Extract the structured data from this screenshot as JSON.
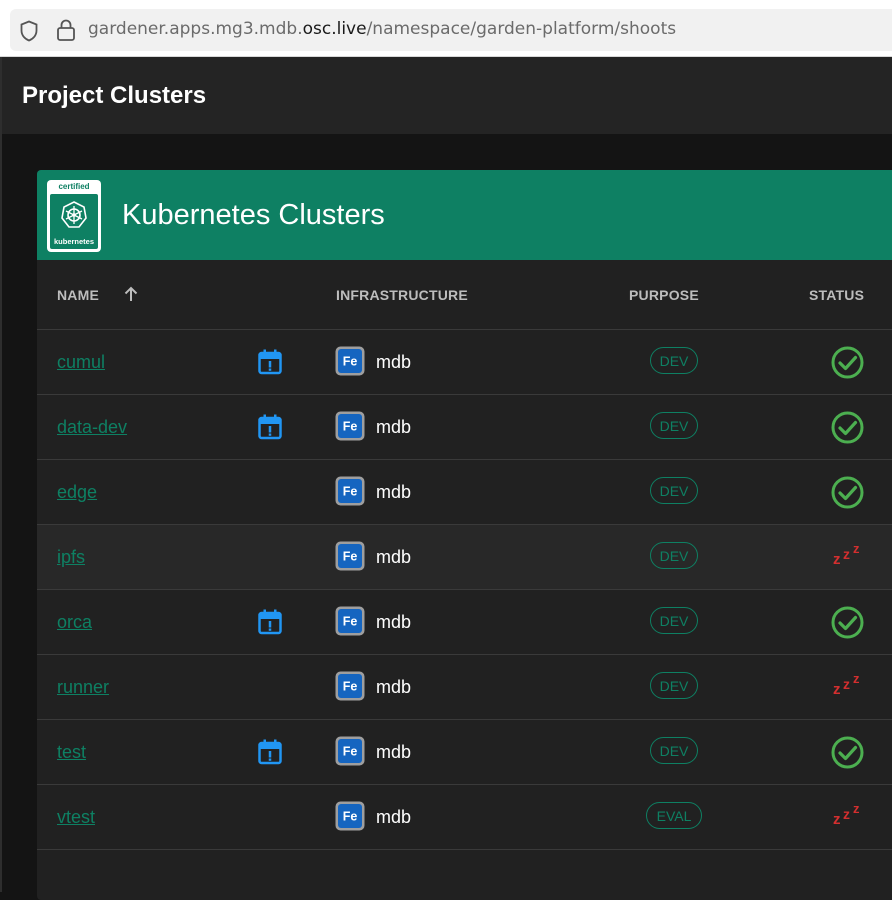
{
  "browser": {
    "url_prefix": "gardener.apps.mg3.mdb.",
    "url_host_strong": "osc.live",
    "url_path": "/namespace/garden-platform/shoots"
  },
  "toolbar": {
    "title": "Project Clusters"
  },
  "card": {
    "title": "Kubernetes Clusters",
    "logo_top_text": "certified",
    "logo_bottom_text": "kubernetes"
  },
  "table": {
    "headers": {
      "name": "NAME",
      "infrastructure": "INFRASTRUCTURE",
      "purpose": "PURPOSE",
      "status": "STATUS"
    },
    "rows": [
      {
        "name": "cumul",
        "scheduled": true,
        "infrastructure": "mdb",
        "infra_icon_text": "Fe",
        "purpose": "DEV",
        "status": "ok"
      },
      {
        "name": "data-dev",
        "scheduled": true,
        "infrastructure": "mdb",
        "infra_icon_text": "Fe",
        "purpose": "DEV",
        "status": "ok"
      },
      {
        "name": "edge",
        "scheduled": false,
        "infrastructure": "mdb",
        "infra_icon_text": "Fe",
        "purpose": "DEV",
        "status": "ok"
      },
      {
        "name": "ipfs",
        "scheduled": false,
        "infrastructure": "mdb",
        "infra_icon_text": "Fe",
        "purpose": "DEV",
        "status": "hibernated"
      },
      {
        "name": "orca",
        "scheduled": true,
        "infrastructure": "mdb",
        "infra_icon_text": "Fe",
        "purpose": "DEV",
        "status": "ok"
      },
      {
        "name": "runner",
        "scheduled": false,
        "infrastructure": "mdb",
        "infra_icon_text": "Fe",
        "purpose": "DEV",
        "status": "hibernated"
      },
      {
        "name": "test",
        "scheduled": true,
        "infrastructure": "mdb",
        "infra_icon_text": "Fe",
        "purpose": "DEV",
        "status": "ok"
      },
      {
        "name": "vtest",
        "scheduled": false,
        "infrastructure": "mdb",
        "infra_icon_text": "Fe",
        "purpose": "EVAL",
        "status": "hibernated"
      }
    ]
  },
  "colors": {
    "accent": "#0e8063",
    "status_ok": "#4caf50",
    "status_hibernated": "#d32f2f",
    "calendar_icon": "#2196f3"
  },
  "icons": {
    "sort": "arrow-up-icon",
    "scheduled": "calendar-alert-icon",
    "infrastructure": "metal-provider-icon",
    "status_ok": "check-circle-icon",
    "status_hibernated": "sleep-zzz-icon"
  }
}
